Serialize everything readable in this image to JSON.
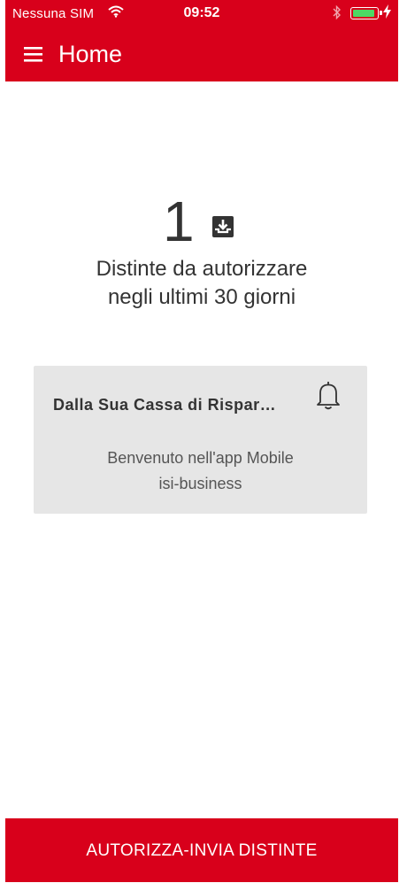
{
  "status_bar": {
    "carrier": "Nessuna SIM",
    "time": "09:52",
    "wifi_icon": "wifi-icon",
    "bluetooth_icon": "bluetooth-icon",
    "battery_icon": "battery-icon",
    "battery_fill_color": "#4cd964"
  },
  "header": {
    "menu_icon": "hamburger-menu-icon",
    "title": "Home",
    "background_color": "#d8001b"
  },
  "summary": {
    "count": "1",
    "count_icon": "inbox-download-icon",
    "label_line1": "Distinte da autorizzare",
    "label_line2": "negli ultimi 30 giorni"
  },
  "notification_card": {
    "title": "Dalla Sua Cassa di Rispar…",
    "bell_icon": "bell-icon",
    "message_line1": "Benvenuto nell'app Mobile",
    "message_line2": "isi-business"
  },
  "footer": {
    "action_label": "AUTORIZZA-INVIA DISTINTE"
  }
}
